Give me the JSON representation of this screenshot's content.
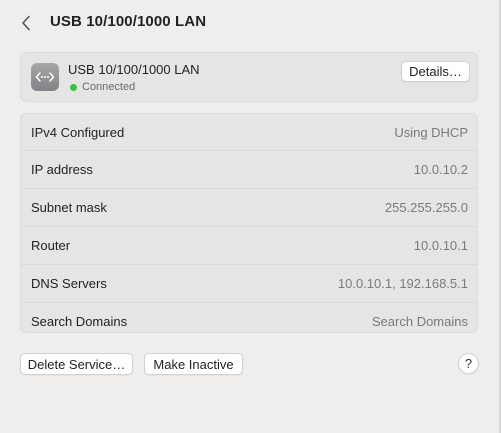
{
  "header": {
    "title": "USB 10/100/1000 LAN"
  },
  "service": {
    "name": "USB 10/100/1000 LAN",
    "status": "Connected",
    "status_color": "#3fbf4a",
    "icon": "ethernet-icon",
    "details_label": "Details…"
  },
  "info_rows": [
    {
      "label": "IPv4 Configured",
      "value": "Using DHCP"
    },
    {
      "label": "IP address",
      "value": "10.0.10.2"
    },
    {
      "label": "Subnet mask",
      "value": "255.255.255.0"
    },
    {
      "label": "Router",
      "value": "10.0.10.1"
    },
    {
      "label": "DNS Servers",
      "value": "10.0.10.1, 192.168.5.1"
    },
    {
      "label": "Search Domains",
      "value": "Search Domains"
    }
  ],
  "footer": {
    "delete_label": "Delete Service…",
    "inactive_label": "Make Inactive",
    "help_label": "?"
  }
}
